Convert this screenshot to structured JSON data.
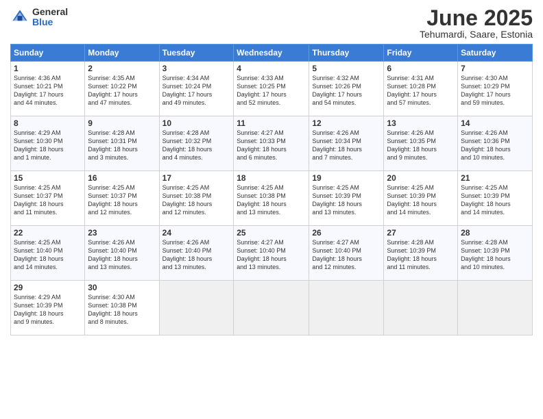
{
  "header": {
    "logo_general": "General",
    "logo_blue": "Blue",
    "month_title": "June 2025",
    "subtitle": "Tehumardi, Saare, Estonia"
  },
  "days_of_week": [
    "Sunday",
    "Monday",
    "Tuesday",
    "Wednesday",
    "Thursday",
    "Friday",
    "Saturday"
  ],
  "weeks": [
    [
      {
        "num": "1",
        "info": "Sunrise: 4:36 AM\nSunset: 10:21 PM\nDaylight: 17 hours\nand 44 minutes."
      },
      {
        "num": "2",
        "info": "Sunrise: 4:35 AM\nSunset: 10:22 PM\nDaylight: 17 hours\nand 47 minutes."
      },
      {
        "num": "3",
        "info": "Sunrise: 4:34 AM\nSunset: 10:24 PM\nDaylight: 17 hours\nand 49 minutes."
      },
      {
        "num": "4",
        "info": "Sunrise: 4:33 AM\nSunset: 10:25 PM\nDaylight: 17 hours\nand 52 minutes."
      },
      {
        "num": "5",
        "info": "Sunrise: 4:32 AM\nSunset: 10:26 PM\nDaylight: 17 hours\nand 54 minutes."
      },
      {
        "num": "6",
        "info": "Sunrise: 4:31 AM\nSunset: 10:28 PM\nDaylight: 17 hours\nand 57 minutes."
      },
      {
        "num": "7",
        "info": "Sunrise: 4:30 AM\nSunset: 10:29 PM\nDaylight: 17 hours\nand 59 minutes."
      }
    ],
    [
      {
        "num": "8",
        "info": "Sunrise: 4:29 AM\nSunset: 10:30 PM\nDaylight: 18 hours\nand 1 minute."
      },
      {
        "num": "9",
        "info": "Sunrise: 4:28 AM\nSunset: 10:31 PM\nDaylight: 18 hours\nand 3 minutes."
      },
      {
        "num": "10",
        "info": "Sunrise: 4:28 AM\nSunset: 10:32 PM\nDaylight: 18 hours\nand 4 minutes."
      },
      {
        "num": "11",
        "info": "Sunrise: 4:27 AM\nSunset: 10:33 PM\nDaylight: 18 hours\nand 6 minutes."
      },
      {
        "num": "12",
        "info": "Sunrise: 4:26 AM\nSunset: 10:34 PM\nDaylight: 18 hours\nand 7 minutes."
      },
      {
        "num": "13",
        "info": "Sunrise: 4:26 AM\nSunset: 10:35 PM\nDaylight: 18 hours\nand 9 minutes."
      },
      {
        "num": "14",
        "info": "Sunrise: 4:26 AM\nSunset: 10:36 PM\nDaylight: 18 hours\nand 10 minutes."
      }
    ],
    [
      {
        "num": "15",
        "info": "Sunrise: 4:25 AM\nSunset: 10:37 PM\nDaylight: 18 hours\nand 11 minutes."
      },
      {
        "num": "16",
        "info": "Sunrise: 4:25 AM\nSunset: 10:37 PM\nDaylight: 18 hours\nand 12 minutes."
      },
      {
        "num": "17",
        "info": "Sunrise: 4:25 AM\nSunset: 10:38 PM\nDaylight: 18 hours\nand 12 minutes."
      },
      {
        "num": "18",
        "info": "Sunrise: 4:25 AM\nSunset: 10:38 PM\nDaylight: 18 hours\nand 13 minutes."
      },
      {
        "num": "19",
        "info": "Sunrise: 4:25 AM\nSunset: 10:39 PM\nDaylight: 18 hours\nand 13 minutes."
      },
      {
        "num": "20",
        "info": "Sunrise: 4:25 AM\nSunset: 10:39 PM\nDaylight: 18 hours\nand 14 minutes."
      },
      {
        "num": "21",
        "info": "Sunrise: 4:25 AM\nSunset: 10:39 PM\nDaylight: 18 hours\nand 14 minutes."
      }
    ],
    [
      {
        "num": "22",
        "info": "Sunrise: 4:25 AM\nSunset: 10:40 PM\nDaylight: 18 hours\nand 14 minutes."
      },
      {
        "num": "23",
        "info": "Sunrise: 4:26 AM\nSunset: 10:40 PM\nDaylight: 18 hours\nand 13 minutes."
      },
      {
        "num": "24",
        "info": "Sunrise: 4:26 AM\nSunset: 10:40 PM\nDaylight: 18 hours\nand 13 minutes."
      },
      {
        "num": "25",
        "info": "Sunrise: 4:27 AM\nSunset: 10:40 PM\nDaylight: 18 hours\nand 13 minutes."
      },
      {
        "num": "26",
        "info": "Sunrise: 4:27 AM\nSunset: 10:40 PM\nDaylight: 18 hours\nand 12 minutes."
      },
      {
        "num": "27",
        "info": "Sunrise: 4:28 AM\nSunset: 10:39 PM\nDaylight: 18 hours\nand 11 minutes."
      },
      {
        "num": "28",
        "info": "Sunrise: 4:28 AM\nSunset: 10:39 PM\nDaylight: 18 hours\nand 10 minutes."
      }
    ],
    [
      {
        "num": "29",
        "info": "Sunrise: 4:29 AM\nSunset: 10:39 PM\nDaylight: 18 hours\nand 9 minutes."
      },
      {
        "num": "30",
        "info": "Sunrise: 4:30 AM\nSunset: 10:38 PM\nDaylight: 18 hours\nand 8 minutes."
      },
      null,
      null,
      null,
      null,
      null
    ]
  ]
}
